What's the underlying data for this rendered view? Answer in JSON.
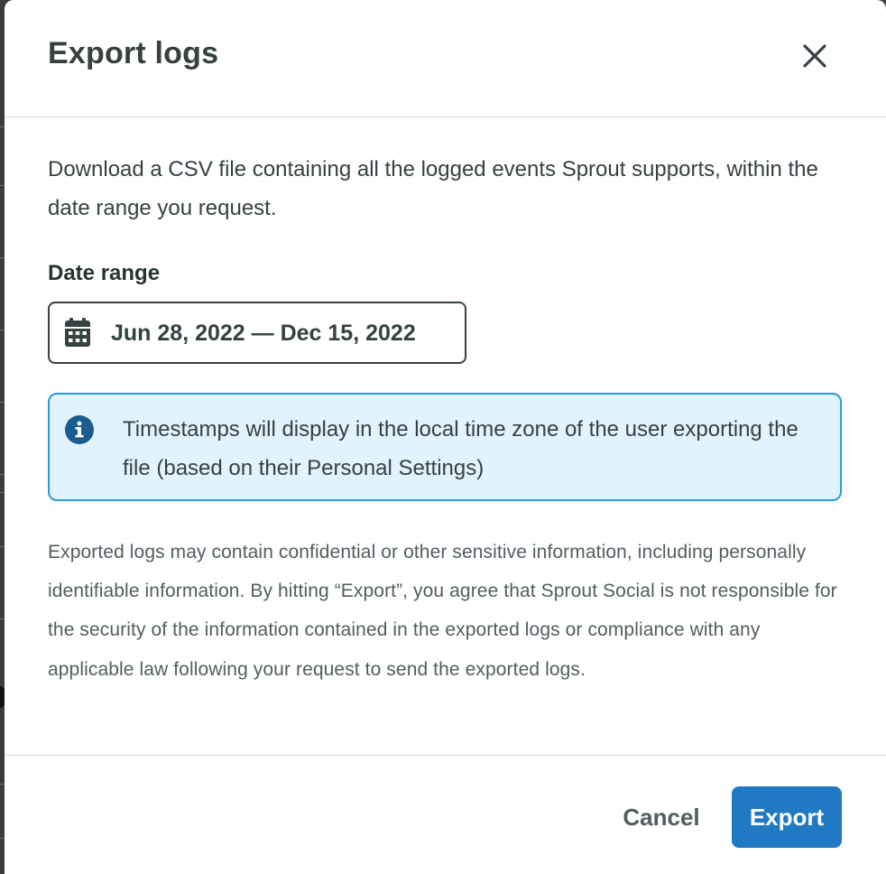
{
  "modal": {
    "title": "Export logs",
    "close_label": "Close"
  },
  "body": {
    "description": "Download a CSV file containing all the logged events Sprout supports, within the date range you request.",
    "date_range": {
      "label": "Date range",
      "value": "Jun 28, 2022 — Dec 15, 2022",
      "icon": "calendar-icon"
    },
    "info_banner": {
      "icon": "info-icon",
      "text": "Timestamps will display in the local time zone of the user exporting the file (based on their Personal Settings)"
    },
    "disclaimer": "Exported logs may contain confidential or other sensitive information, including personally identifiable information. By hitting “Export”, you agree that Sprout Social is not responsible for the security of the information contained in the exported logs or compliance with any applicable law following your request to send the exported logs."
  },
  "footer": {
    "cancel_label": "Cancel",
    "export_label": "Export"
  },
  "colors": {
    "primary": "#2079c3",
    "info_background": "#e1f4fd",
    "info_border": "#2c9ad8",
    "text_dark": "#364141"
  }
}
